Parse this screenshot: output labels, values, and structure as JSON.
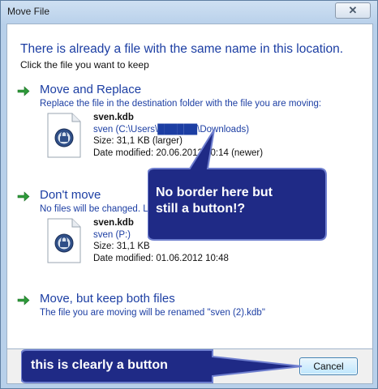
{
  "window": {
    "title": "Move File",
    "close_symbol": "✕"
  },
  "header": {
    "heading": "There is already a file with the same name in this location.",
    "instruction": "Click the file you want to keep"
  },
  "options": [
    {
      "title": "Move and Replace",
      "description": "Replace the file in the destination folder with the file you are moving:",
      "file": {
        "name": "sven.kdb",
        "path": "sven (C:\\Users\\██████\\Downloads)",
        "size": "Size: 31,1 KB (larger)",
        "modified": "Date modified: 20.06.2012 10:14 (newer)"
      }
    },
    {
      "title": "Don't move",
      "description": "No files will be changed. L",
      "file": {
        "name": "sven.kdb",
        "path": "sven (P:)",
        "size": "Size: 31,1 KB",
        "modified": "Date modified: 01.06.2012 10:48"
      }
    },
    {
      "title": "Move, but keep both files",
      "description": "The file you are moving will be renamed \"sven (2).kdb\""
    }
  ],
  "footer": {
    "cancel_label": "Cancel"
  },
  "annotations": {
    "callout_1_line_1": "No border here but",
    "callout_1_line_2": "still a button!?",
    "callout_2": "this is clearly a button"
  },
  "colors": {
    "link_blue": "#1c3ea3",
    "arrow_green": "#2e9a3a",
    "callout_fill": "#1f2a86"
  }
}
